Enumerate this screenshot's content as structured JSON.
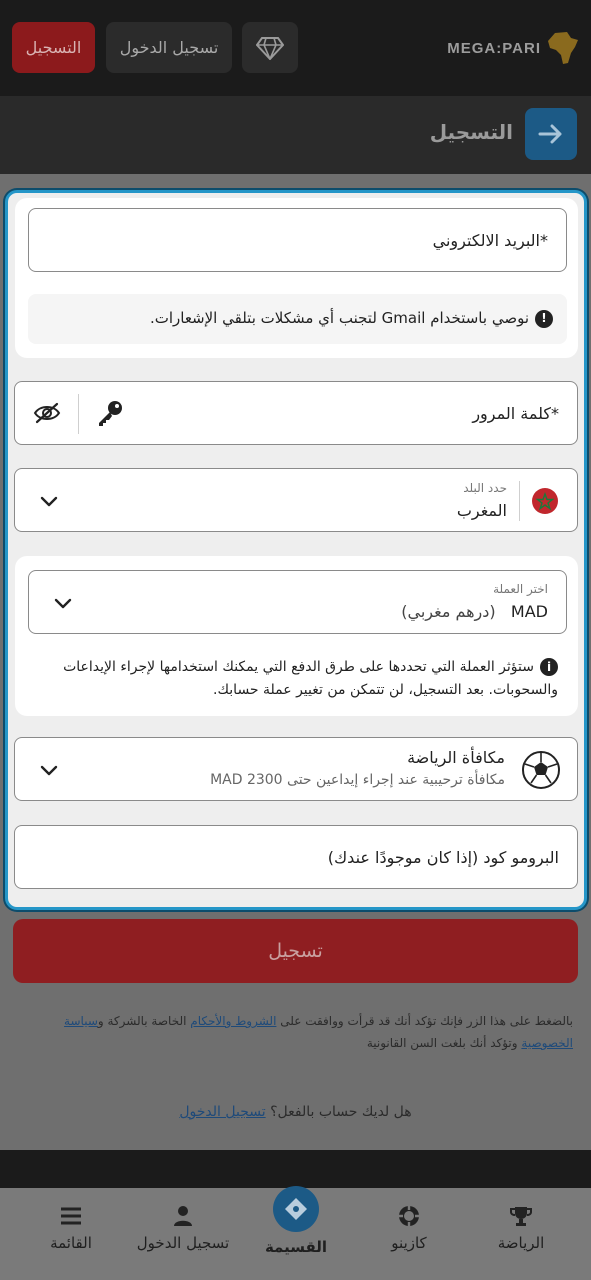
{
  "header": {
    "register_label": "التسجيل",
    "login_label": "تسجيل الدخول",
    "logo_text": "MEGA:PARI",
    "title": "التسجيل"
  },
  "form": {
    "email_placeholder": "البريد الالكتروني*",
    "gmail_note": "نوصي باستخدام Gmail لتجنب أي مشكلات بتلقي الإشعارات.",
    "password_placeholder": "كلمة المرور*",
    "country_label": "حدد البلد",
    "country_value": "المغرب",
    "currency_label": "اختر العملة",
    "currency_code": "MAD",
    "currency_name": "(درهم مغربي)",
    "currency_note": "ستؤثر العملة التي تحددها على طرق الدفع التي يمكنك استخدامها لإجراء الإيداعات والسحوبات. بعد التسجيل، لن تتمكن من تغيير عملة حسابك.",
    "bonus_title": "مكافأة الرياضة",
    "bonus_desc": "مكافأة ترحيبية عند إجراء إيداعين حتى MAD 2300",
    "promo_placeholder": "البرومو كود (إذا كان موجودًا عندك)"
  },
  "submit_label": "تسجيل",
  "terms": {
    "prefix": "بالضغط على هذا الزر فإنك تؤكد أنك قد قرأت ووافقت على",
    "terms_link": "الشروط والأحكام",
    "middle": "الخاصة بالشركة و",
    "privacy_link": "سياسة الخصوصية",
    "suffix": "وتؤكد أنك بلغت السن القانونية"
  },
  "have_account": {
    "text": "هل لديك حساب بالفعل؟",
    "link": "تسجيل الدخول"
  },
  "bottom_nav": {
    "sports": "الرياضة",
    "casino": "كازينو",
    "coupon": "القسيمة",
    "login": "تسجيل الدخول",
    "menu": "القائمة"
  },
  "colors": {
    "accent_blue": "#2596c8",
    "register_red": "#8f1e21"
  }
}
